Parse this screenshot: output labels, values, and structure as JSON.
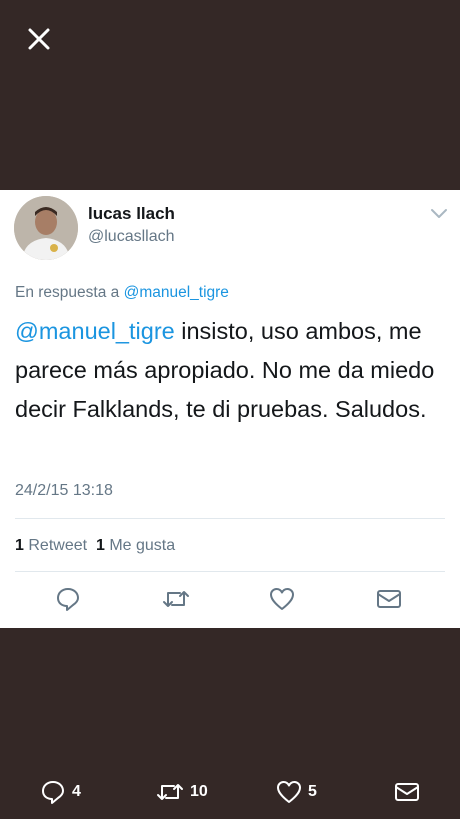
{
  "tweet": {
    "display_name": "lucas llach",
    "handle": "@lucasllach",
    "reply_prefix": "En respuesta a",
    "reply_to": "@manuel_tigre",
    "text_mention": "@manuel_tigre",
    "text_body": " insisto, uso ambos, me parece más apropiado. No me da miedo decir Falklands, te di pruebas. Saludos.",
    "timestamp": "24/2/15 13:18",
    "retweet_count": "1",
    "retweet_label": "Retweet",
    "like_count": "1",
    "like_label": "Me gusta"
  },
  "bottom_bar": {
    "replies": "4",
    "retweets": "10",
    "likes": "5"
  },
  "colors": {
    "background": "#342826",
    "link": "#1b95e0",
    "secondary_text": "#657786",
    "primary_text": "#14171a"
  },
  "icons": [
    "close-icon",
    "chevron-down-icon",
    "reply-icon",
    "retweet-icon",
    "heart-icon",
    "envelope-icon"
  ]
}
